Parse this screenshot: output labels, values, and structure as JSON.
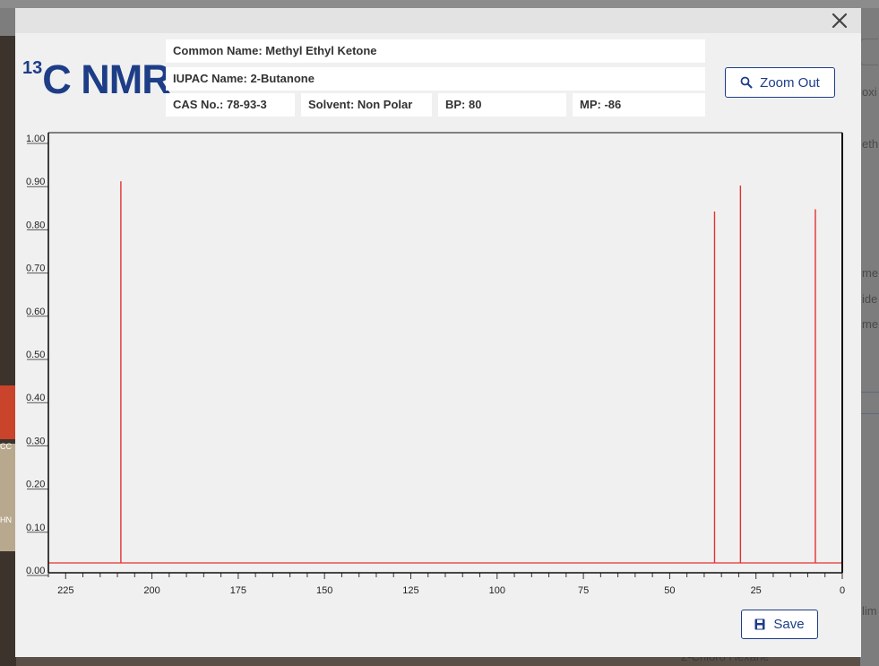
{
  "background": {
    "left_labels": [
      "CC",
      "HN"
    ],
    "right_texts": [
      "oxi",
      "eth",
      "me",
      "ide",
      "me",
      "lim"
    ],
    "bottom_text": "2-Chloro Hexane"
  },
  "modal": {
    "title_sup": "13",
    "title_main": "C NMR",
    "common_name": "Common Name: Methyl Ethyl Ketone",
    "iupac_name": "IUPAC Name: 2-Butanone",
    "cas": "CAS No.: 78-93-3",
    "solvent": "Solvent: Non Polar",
    "bp": "BP: 80",
    "mp": "MP: -86",
    "zoom_out_label": "Zoom Out",
    "save_label": "Save",
    "icons": {
      "close": "close-icon",
      "zoom": "magnify-icon",
      "save": "floppy-icon"
    }
  },
  "chart_data": {
    "type": "line",
    "subtype": "nmr-stick-spectrum",
    "x_reversed": true,
    "xlim": [
      230,
      0
    ],
    "ylim": [
      0,
      1.0
    ],
    "x_ticks": [
      225,
      200,
      175,
      150,
      125,
      100,
      75,
      50,
      25,
      0
    ],
    "y_ticks": [
      "0.00",
      "0.10",
      "0.20",
      "0.30",
      "0.40",
      "0.50",
      "0.60",
      "0.70",
      "0.80",
      "0.90",
      "1.00"
    ],
    "peaks": [
      {
        "x": 209.0,
        "y": 0.9
      },
      {
        "x": 37.0,
        "y": 0.83
      },
      {
        "x": 29.5,
        "y": 0.89
      },
      {
        "x": 7.8,
        "y": 0.835
      }
    ],
    "colors": {
      "peak": "#e53030",
      "baseline": "#e53030",
      "axis": "#111111"
    }
  }
}
